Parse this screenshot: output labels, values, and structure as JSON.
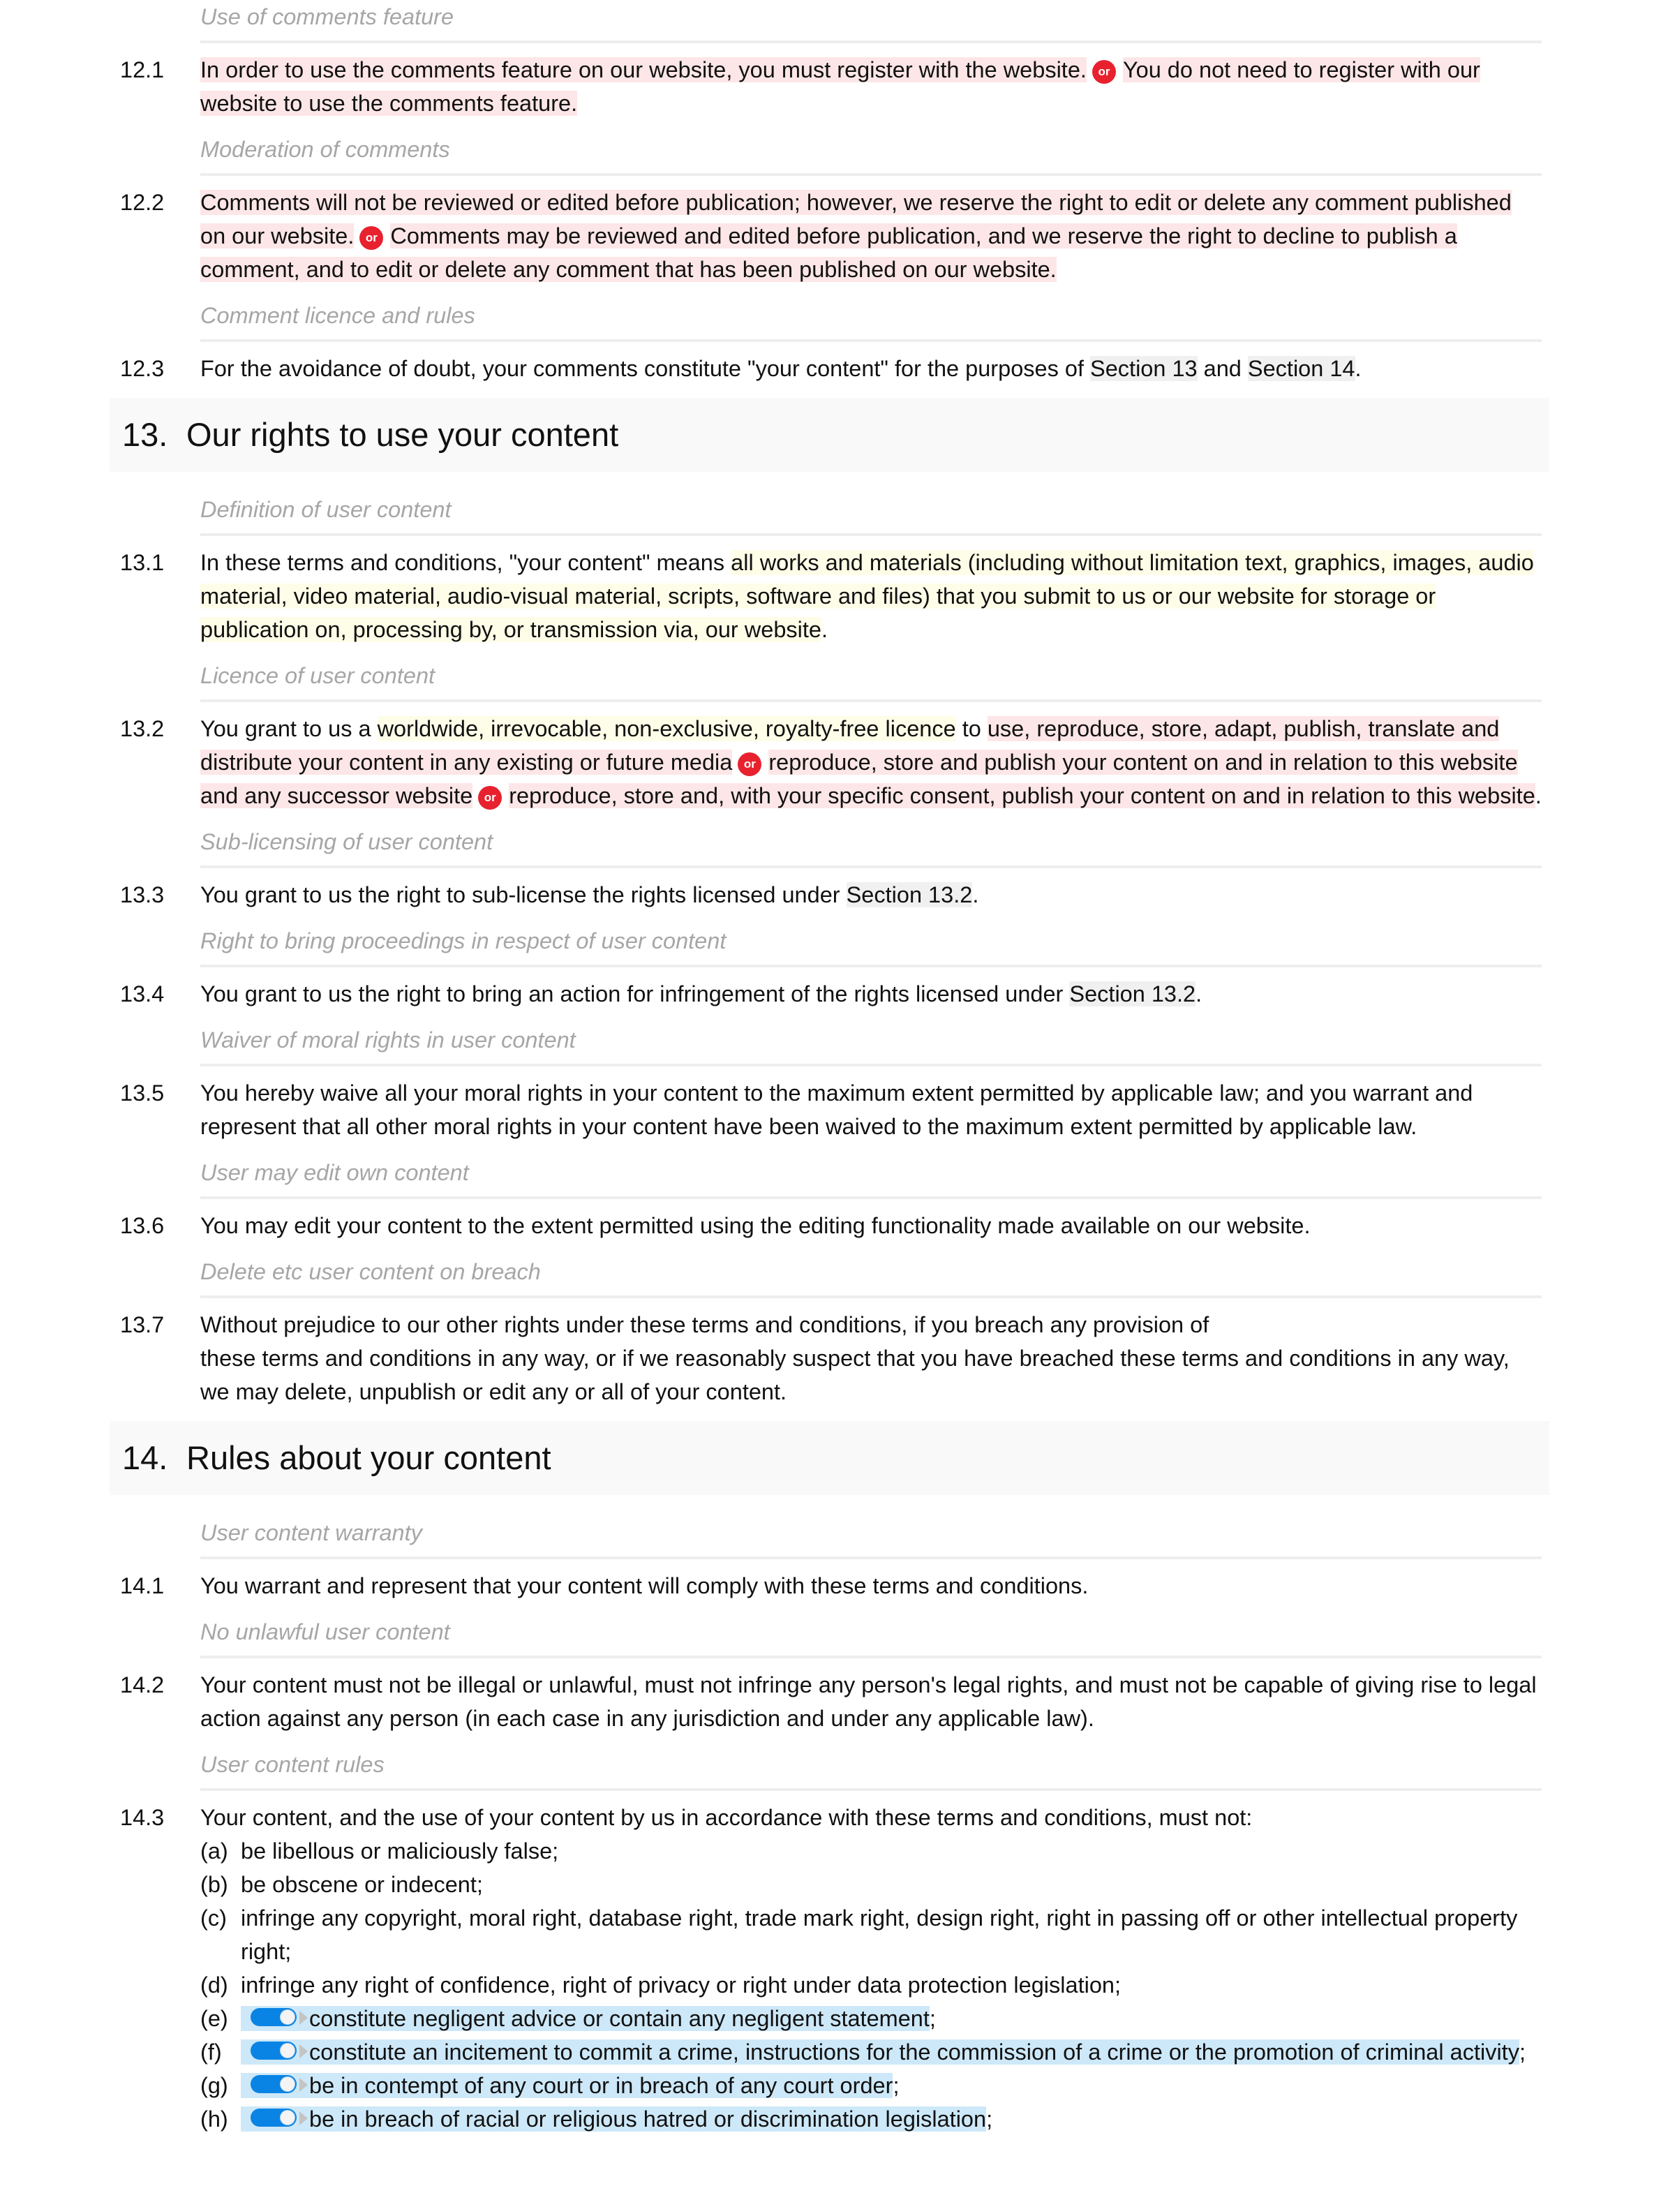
{
  "colors": {
    "option_highlight": "#fde6e7",
    "definition_highlight": "#fefde8",
    "optional_highlight": "#cde8f8",
    "or_badge": "#e8212e",
    "toggle": "#0a84e4",
    "section_ref": "#f0f0f0",
    "heading_bg": "#f9f9f9",
    "subhead_text": "#a6a6a6"
  },
  "or_label": "or",
  "s12": {
    "c1": {
      "subhead": "Use of comments feature",
      "num": "12.1",
      "opt1": "In order to use the comments feature on our website, you must register with the website.",
      "opt2": "You do not need to register with our website to use the comments feature."
    },
    "c2": {
      "subhead": "Moderation of comments",
      "num": "12.2",
      "opt1": "Comments will not be reviewed or edited before publication; however, we reserve the right to edit or delete any comment published on our website.",
      "opt2": "Comments may be reviewed and edited before publication, and we reserve the right to decline to publish a comment, and to edit or delete any comment that has been published on our website."
    },
    "c3": {
      "subhead": "Comment licence and rules",
      "num": "12.3",
      "text1": "For the avoidance of doubt, your comments constitute \"your content\" for the purposes of ",
      "ref1": "Section 13",
      "text2": " and ",
      "ref2": "Section 14",
      "text3": "."
    }
  },
  "s13": {
    "heading_num": "13.",
    "heading_title": "Our rights to use your content",
    "c1": {
      "subhead": "Definition of user content",
      "num": "13.1",
      "text1": "In these terms and conditions, \"your content\" means ",
      "def": "all works and materials (including without limitation text, graphics, images, audio material, video material, audio-visual material, scripts, software and files) that you submit to us or our website for storage or publication on, processing by, or transmission via, our website",
      "text2": "."
    },
    "c2": {
      "subhead": "Licence of user content",
      "num": "13.2",
      "text1": "You grant to us a ",
      "def": "worldwide, irrevocable, non-exclusive, royalty-free licence",
      "text2": " to ",
      "opt1": "use, reproduce, store, adapt, publish, translate and distribute your content in any existing or future media",
      "opt2": "reproduce, store and publish your content on and in relation to this website and any successor website",
      "opt3": "reproduce, store and, with your specific consent, publish your content on and in relation to this website",
      "text3": "."
    },
    "c3": {
      "subhead": "Sub-licensing of user content",
      "num": "13.3",
      "text1": "You grant to us the right to sub-license the rights licensed under ",
      "ref": "Section 13.2",
      "text2": "."
    },
    "c4": {
      "subhead": "Right to bring proceedings in respect of user content",
      "num": "13.4",
      "text1": "You grant to us the right to bring an action for infringement of the rights licensed under ",
      "ref": "Section 13.2",
      "text2": "."
    },
    "c5": {
      "subhead": "Waiver of moral rights in user content",
      "num": "13.5",
      "text": "You hereby waive all your moral rights in your content to the maximum extent permitted by applicable law; and you warrant and represent that all other moral rights in your content have been waived to the maximum extent permitted by applicable law."
    },
    "c6": {
      "subhead": "User may edit own content",
      "num": "13.6",
      "text": "You may edit your content to the extent permitted using the editing functionality made available on our website."
    },
    "c7": {
      "subhead": "Delete etc user content on breach",
      "num": "13.7",
      "line1": "Without prejudice to our other rights under these terms and conditions, if you breach any provision of",
      "line2": "these terms and conditions in any way, or if we reasonably suspect that you have breached these terms and conditions in any way, we may delete, unpublish or edit any or all of your content."
    }
  },
  "s14": {
    "heading_num": "14.",
    "heading_title": "Rules about your content",
    "c1": {
      "subhead": "User content warranty",
      "num": "14.1",
      "text": "You warrant and represent that your content will comply with these terms and conditions."
    },
    "c2": {
      "subhead": "No unlawful user content",
      "num": "14.2",
      "text": "Your content must not be illegal or unlawful, must not infringe any person's legal rights, and must not be capable of giving rise to legal action against any person (in each case in any jurisdiction and under any applicable law)."
    },
    "c3": {
      "subhead": "User content rules",
      "num": "14.3",
      "text": "Your content, and the use of your content by us in accordance with these terms and conditions, must not:",
      "items": [
        {
          "letter": "(a)",
          "text": "be libellous or maliciously false;",
          "optional": false
        },
        {
          "letter": "(b)",
          "text": "be obscene or indecent;",
          "optional": false
        },
        {
          "letter": "(c)",
          "text": "infringe any copyright, moral right, database right, trade mark right, design right, right in passing off or other intellectual property right;",
          "optional": false
        },
        {
          "letter": "(d)",
          "text": "infringe any right of confidence, right of privacy or right under data protection legislation;",
          "optional": false
        },
        {
          "letter": "(e)",
          "text": "constitute negligent advice or contain any negligent statement",
          "suffix": ";",
          "optional": true,
          "enabled": true
        },
        {
          "letter": "(f)",
          "text": "constitute an incitement to commit a crime, instructions for the commission of a crime or the promotion of criminal activity",
          "suffix": ";",
          "optional": true,
          "enabled": true
        },
        {
          "letter": "(g)",
          "text": "be in contempt of any court or in breach of any court order",
          "suffix": ";",
          "optional": true,
          "enabled": true
        },
        {
          "letter": "(h)",
          "text": "be in breach of racial or religious hatred or discrimination legislation",
          "suffix": ";",
          "optional": true,
          "enabled": true
        }
      ]
    }
  }
}
